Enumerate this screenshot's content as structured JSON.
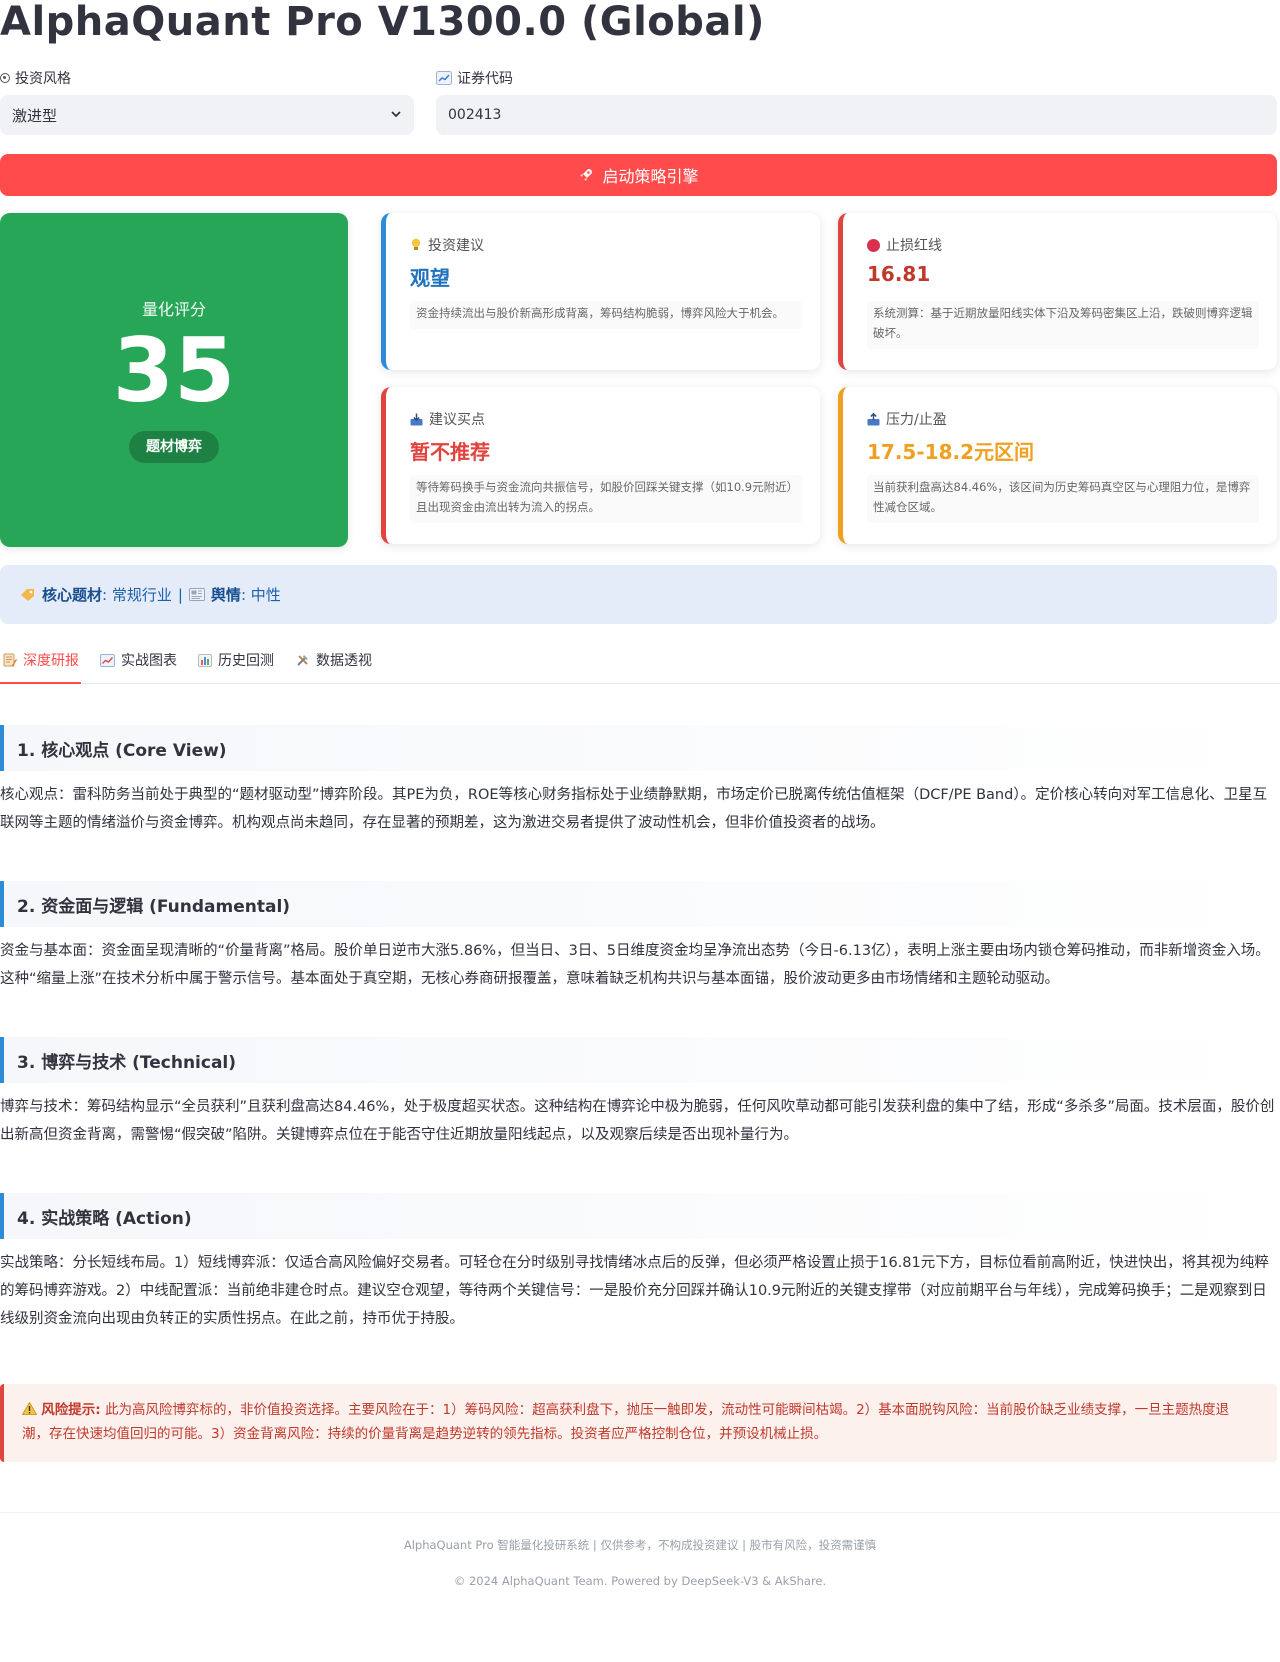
{
  "app": {
    "title": "AlphaQuant Pro V1300.0 (Global)"
  },
  "controls": {
    "style_label": "投资风格",
    "style_value": "激进型",
    "code_label": "证券代码",
    "code_value": "002413",
    "run_label": "启动策略引擎"
  },
  "score": {
    "label": "量化评分",
    "value": "35",
    "badge": "题材博弈",
    "color": "#27a658"
  },
  "cards": {
    "advice": {
      "title": "投资建议",
      "value": "观望",
      "desc": "资金持续流出与股价新高形成背离，筹码结构脆弱，博弈风险大于机会。",
      "accent": "#2e8bd8",
      "value_color": "#2172bf"
    },
    "stop": {
      "title": "止损红线",
      "value": "16.81",
      "desc": "系统测算：基于近期放量阳线实体下沿及筹码密集区上沿，跌破则博弈逻辑破坏。",
      "accent": "#e0443f",
      "value_color": "#c0392b"
    },
    "buy": {
      "title": "建议买点",
      "value": "暂不推荐",
      "desc": "等待筹码换手与资金流向共振信号，如股价回踩关键支撑（如10.9元附近）且出现资金由流出转为流入的拐点。",
      "accent": "#e0443f",
      "value_color": "#e0443f"
    },
    "resist": {
      "title": "压力/止盈",
      "value": "17.5-18.2元区间",
      "desc": "当前获利盘高达84.46%，该区间为历史筹码真空区与心理阻力位，是博弈性减仓区域。",
      "accent": "#f0a020",
      "value_color": "#f0a020"
    }
  },
  "topic": {
    "core_label": "核心题材",
    "core_value": "常规行业",
    "sentiment_label": "舆情",
    "sentiment_value": "中性",
    "separator": "|"
  },
  "tabs": [
    {
      "label": "深度研报"
    },
    {
      "label": "实战图表"
    },
    {
      "label": "历史回测"
    },
    {
      "label": "数据透视"
    }
  ],
  "sections": [
    {
      "title": "1. 核心观点 (Core View)",
      "body": "核心观点：雷科防务当前处于典型的“题材驱动型”博弈阶段。其PE为负，ROE等核心财务指标处于业绩静默期，市场定价已脱离传统估值框架（DCF/PE Band）。定价核心转向对军工信息化、卫星互联网等主题的情绪溢价与资金博弈。机构观点尚未趋同，存在显著的预期差，这为激进交易者提供了波动性机会，但非价值投资者的战场。"
    },
    {
      "title": "2. 资金面与逻辑 (Fundamental)",
      "body": "资金与基本面：资金面呈现清晰的“价量背离”格局。股价单日逆市大涨5.86%，但当日、3日、5日维度资金均呈净流出态势（今日-6.13亿），表明上涨主要由场内锁仓筹码推动，而非新增资金入场。这种“缩量上涨”在技术分析中属于警示信号。基本面处于真空期，无核心券商研报覆盖，意味着缺乏机构共识与基本面锚，股价波动更多由市场情绪和主题轮动驱动。"
    },
    {
      "title": "3. 博弈与技术 (Technical)",
      "body": "博弈与技术：筹码结构显示“全员获利”且获利盘高达84.46%，处于极度超买状态。这种结构在博弈论中极为脆弱，任何风吹草动都可能引发获利盘的集中了结，形成“多杀多”局面。技术层面，股价创出新高但资金背离，需警惕“假突破”陷阱。关键博弈点位在于能否守住近期放量阳线起点，以及观察后续是否出现补量行为。"
    },
    {
      "title": "4. 实战策略 (Action)",
      "body": "实战策略：分长短线布局。1）短线博弈派：仅适合高风险偏好交易者。可轻仓在分时级别寻找情绪冰点后的反弹，但必须严格设置止损于16.81元下方，目标位看前高附近，快进快出，将其视为纯粹的筹码博弈游戏。2）中线配置派：当前绝非建仓时点。建议空仓观望，等待两个关键信号：一是股价充分回踩并确认10.9元附近的关键支撑带（对应前期平台与年线），完成筹码换手；二是观察到日线级别资金流向出现由负转正的实质性拐点。在此之前，持币优于持股。"
    }
  ],
  "risk": {
    "label": "风险提示:",
    "text": "此为高风险博弈标的，非价值投资选择。主要风险在于：1）筹码风险：超高获利盘下，抛压一触即发，流动性可能瞬间枯竭。2）基本面脱钩风险：当前股价缺乏业绩支撑，一旦主题热度退潮，存在快速均值回归的可能。3）资金背离风险：持续的价量背离是趋势逆转的领先指标。投资者应严格控制仓位，并预设机械止损。"
  },
  "footer": {
    "line1": "AlphaQuant Pro 智能量化投研系统 | 仅供参考，不构成投资建议 | 股市有风险，投资需谨慎",
    "line2": "© 2024 AlphaQuant Team. Powered by DeepSeek-V3 & AkShare."
  },
  "colors": {
    "accent": "#ff4b4b",
    "score_green": "#27a658",
    "info_blue": "#2e8bd8",
    "banner_bg": "#e3ecf8",
    "risk_red": "#c0392b"
  }
}
